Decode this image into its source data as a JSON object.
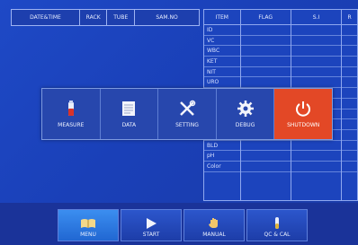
{
  "header": {
    "columns": [
      "DATE&TIME",
      "RACK",
      "TUBE",
      "SAM.NO"
    ]
  },
  "result_table": {
    "columns": [
      "ITEM",
      "FLAG",
      "S.I",
      "R"
    ],
    "rows": [
      "ID",
      "VC",
      "WBC",
      "KET",
      "NIT",
      "URO",
      "",
      "",
      "",
      "",
      "SG",
      "BLD",
      "pH",
      "Color"
    ]
  },
  "menu": {
    "items": [
      {
        "label": "MEASURE",
        "icon": "measure-icon"
      },
      {
        "label": "DATA",
        "icon": "data-icon"
      },
      {
        "label": "SETTING",
        "icon": "setting-icon"
      },
      {
        "label": "DEBUG",
        "icon": "debug-icon"
      },
      {
        "label": "SHUTDOWN",
        "icon": "shutdown-icon"
      }
    ],
    "active": "SHUTDOWN"
  },
  "bottom_bar": {
    "buttons": [
      {
        "label": "MENU",
        "icon": "book-icon"
      },
      {
        "label": "START",
        "icon": "play-icon"
      },
      {
        "label": "MANUAL",
        "icon": "hand-icon"
      },
      {
        "label": "QC & CAL",
        "icon": "tube-icon"
      }
    ],
    "active": "MENU"
  },
  "colors": {
    "background": "#1a40b8",
    "active_menu": "#e34826",
    "active_button": "#2f7ce6"
  }
}
